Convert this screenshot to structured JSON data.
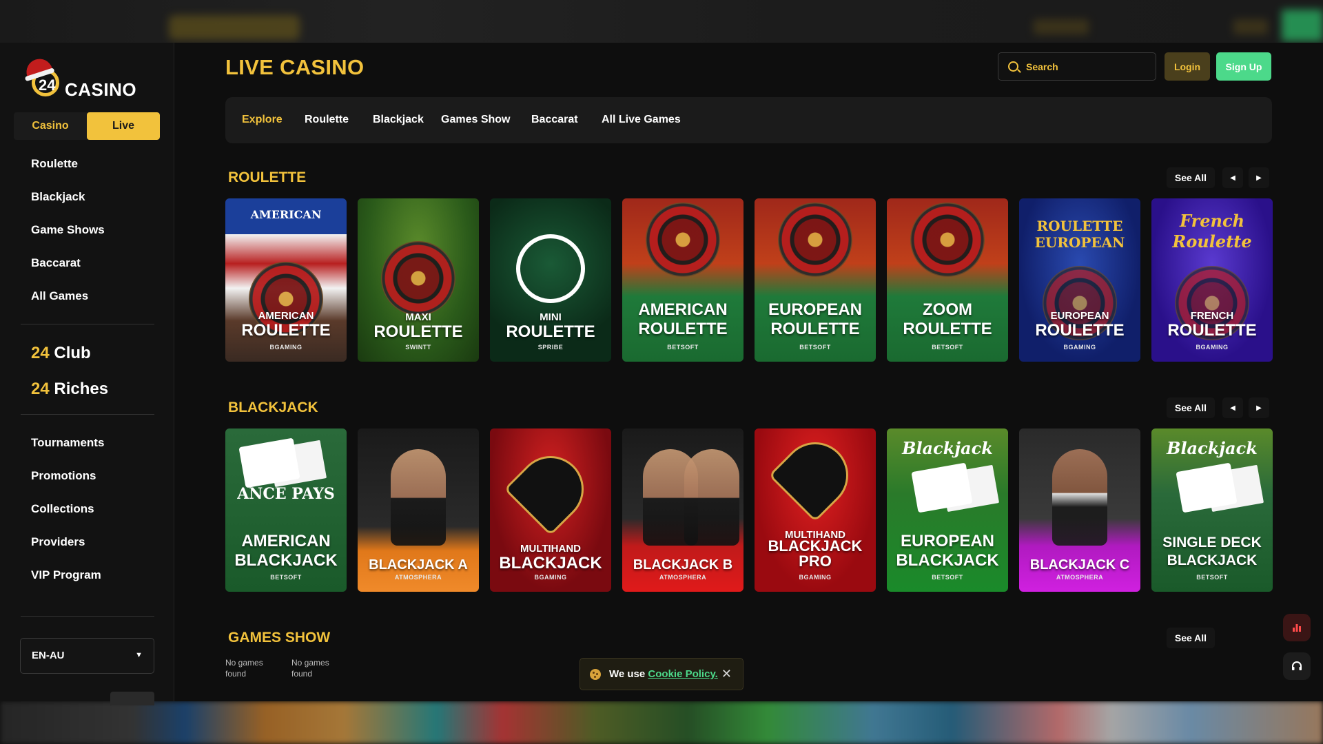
{
  "brand": {
    "logo_number": "24",
    "logo_word": "CASINO"
  },
  "mode_toggle": {
    "casino": "Casino",
    "live": "Live",
    "active": "Live"
  },
  "sidebar": {
    "nav_top": [
      "Roulette",
      "Blackjack",
      "Game Shows",
      "Baccarat",
      "All Games"
    ],
    "clubs": [
      {
        "num": "24",
        "word": "Club"
      },
      {
        "num": "24",
        "word": "Riches"
      }
    ],
    "nav_bottom": [
      "Tournaments",
      "Promotions",
      "Collections",
      "Providers",
      "VIP Program"
    ],
    "language": "EN-AU"
  },
  "header": {
    "title": "LIVE CASINO",
    "search_placeholder": "Search",
    "login": "Login",
    "signup": "Sign Up"
  },
  "tabs": [
    {
      "label": "Explore",
      "active": true
    },
    {
      "label": "Roulette"
    },
    {
      "label": "Blackjack"
    },
    {
      "label": "Games Show"
    },
    {
      "label": "Baccarat"
    },
    {
      "label": "All Live Games"
    }
  ],
  "sections": {
    "roulette": {
      "title": "ROULETTE",
      "see_all": "See All",
      "games": [
        {
          "top": "AMERICAN",
          "l1": "AMERICAN",
          "l2": "ROULETTE",
          "provider": "BGAMING",
          "bg": "#7a2020"
        },
        {
          "top": "",
          "l1": "MAXI",
          "l2": "ROULETTE",
          "provider": "SWINTT",
          "bg": "#2f6b2a"
        },
        {
          "top": "",
          "l1": "MINI",
          "l2": "ROULETTE",
          "provider": "SPRIBE",
          "bg": "#0f3a22"
        },
        {
          "top": "",
          "l1": "AMERICAN",
          "l2": "ROULETTE",
          "provider": "BETSOFT",
          "bg": "#1f7a3a"
        },
        {
          "top": "",
          "l1": "EUROPEAN",
          "l2": "ROULETTE",
          "provider": "BETSOFT",
          "bg": "#1f7a3a"
        },
        {
          "top": "",
          "l1": "ZOOM",
          "l2": "ROULETTE",
          "provider": "BETSOFT",
          "bg": "#1f7a3a"
        },
        {
          "top": "ROULETTE EUROPEAN",
          "l1": "EUROPEAN",
          "l2": "ROULETTE",
          "provider": "BGAMING",
          "bg": "#1a2d7a"
        },
        {
          "top": "French Roulette",
          "l1": "FRENCH",
          "l2": "ROULETTE",
          "provider": "BGAMING",
          "bg": "#3a1f9a"
        }
      ]
    },
    "blackjack": {
      "title": "BLACKJACK",
      "see_all": "See All",
      "games": [
        {
          "top": "ANCE PAYS",
          "l1": "AMERICAN",
          "l2": "BLACKJACK",
          "provider": "BETSOFT",
          "bg": "#1f6a3a"
        },
        {
          "top": "",
          "l1": "",
          "l2": "BLACKJACK A",
          "provider": "ATMOSPHERA",
          "bg": "#e0781a"
        },
        {
          "top": "",
          "l1": "MULTIHAND",
          "l2": "BLACKJACK",
          "provider": "BGAMING",
          "bg": "#8a0f14"
        },
        {
          "top": "",
          "l1": "",
          "l2": "BLACKJACK B",
          "provider": "ATMOSPHERA",
          "bg": "#d0141a"
        },
        {
          "top": "",
          "l1": "MULTIHAND",
          "l2": "BLACKJACK PRO",
          "provider": "BGAMING",
          "bg": "#b0121a"
        },
        {
          "top": "Blackjack",
          "l1": "EUROPEAN",
          "l2": "BLACKJACK",
          "provider": "BETSOFT",
          "bg": "#1f8a2a"
        },
        {
          "top": "",
          "l1": "",
          "l2": "BLACKJACK C",
          "provider": "ATMOSPHERA",
          "bg": "#c01ad0"
        },
        {
          "top": "Blackjack",
          "l1": "SINGLE DECK",
          "l2": "BLACKJACK",
          "provider": "BETSOFT",
          "bg": "#1f6a3a"
        }
      ]
    },
    "games_show": {
      "title": "GAMES SHOW",
      "see_all": "See All",
      "empty": [
        "No games found",
        "No games found"
      ]
    }
  },
  "cookie": {
    "prefix": "We use",
    "link": "Cookie Policy."
  },
  "colors": {
    "accent": "#f2c23c",
    "signup": "#4cd98a",
    "bg": "#0e0e0e"
  }
}
